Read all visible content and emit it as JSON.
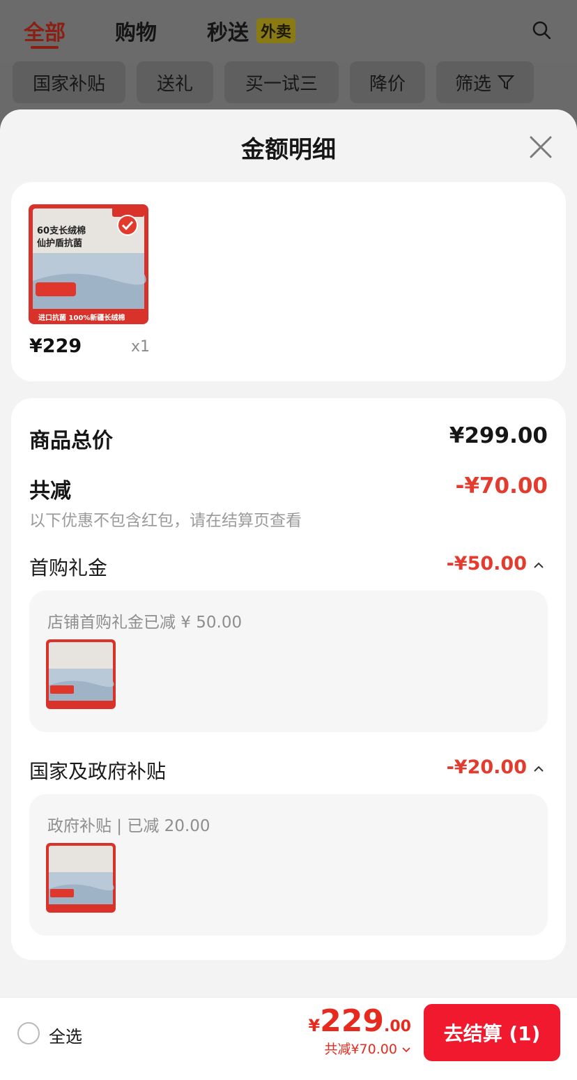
{
  "background": {
    "tabs": [
      "全部",
      "购物",
      "秒送"
    ],
    "badge": "外卖",
    "chips": [
      "国家补贴",
      "送礼",
      "买一试三",
      "降价",
      "筛选"
    ]
  },
  "sheet": {
    "title": "金额明细"
  },
  "product": {
    "image_text": {
      "headline_1": "60支长绒棉",
      "headline_2": "仙护盾抗菌",
      "footer": "进口抗菌 100%新疆长绒棉"
    },
    "price": "¥229",
    "quantity": "x1"
  },
  "summary": {
    "total_label": "商品总价",
    "total_value": "¥299.00",
    "discount_label": "共减",
    "discount_value": "-¥70.00",
    "note": "以下优惠不包含红包，请在结算页查看",
    "items": [
      {
        "label": "首购礼金",
        "value": "-¥50.00",
        "detail": "店铺首购礼金已减 ¥ 50.00"
      },
      {
        "label": "国家及政府补贴",
        "value": "-¥20.00",
        "detail": "政府补贴 | 已减 20.00"
      }
    ]
  },
  "bottom": {
    "select_all": "全选",
    "currency": "¥",
    "total_int": "229",
    "total_dec": ".00",
    "saved": "共减¥70.00",
    "checkout": "去结算 (1)"
  },
  "colors": {
    "accent_red": "#e33b2d",
    "button_red": "#f0192e"
  }
}
